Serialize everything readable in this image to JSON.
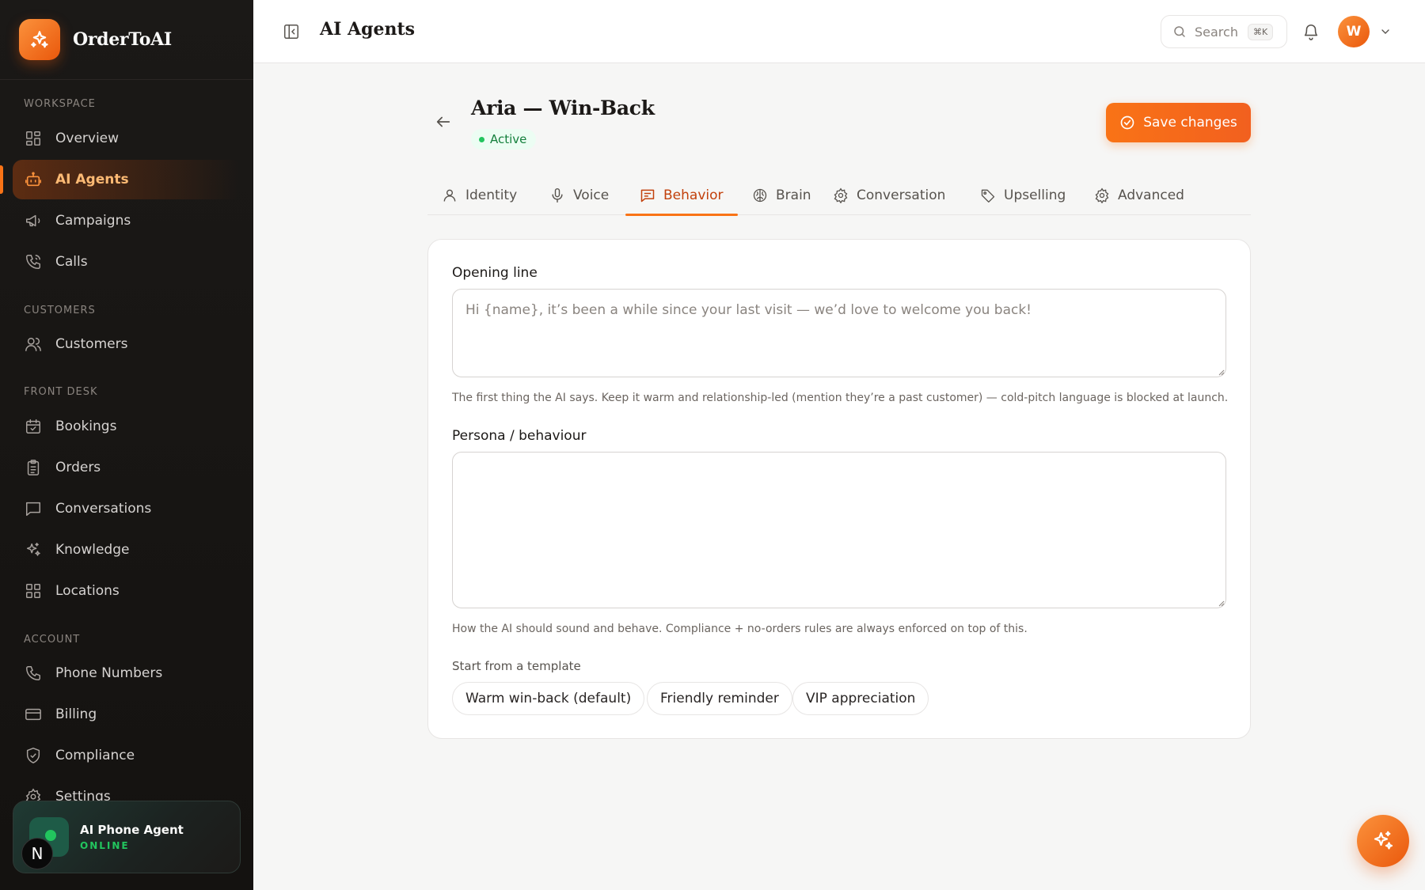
{
  "app": {
    "name": "OrderToAI",
    "colors": {
      "accent": "#f97316",
      "sidebar_bg": "#1b1917",
      "success": "#22c55e"
    }
  },
  "sidebar": {
    "sections": [
      {
        "label": "WORKSPACE"
      },
      {
        "label": "CUSTOMERS"
      },
      {
        "label": "FRONT DESK"
      },
      {
        "label": "ACCOUNT"
      }
    ],
    "items": [
      {
        "label": "Overview",
        "icon": "grid-icon"
      },
      {
        "label": "AI Agents",
        "icon": "robot-icon",
        "active": true
      },
      {
        "label": "Campaigns",
        "icon": "megaphone-icon"
      },
      {
        "label": "Calls",
        "icon": "phone-call-icon"
      },
      {
        "label": "Customers",
        "icon": "users-icon"
      },
      {
        "label": "Bookings",
        "icon": "calendar-icon"
      },
      {
        "label": "Orders",
        "icon": "clipboard-icon"
      },
      {
        "label": "Conversations",
        "icon": "chat-icon"
      },
      {
        "label": "Knowledge",
        "icon": "sparkles-icon"
      },
      {
        "label": "Locations",
        "icon": "grid-icon"
      },
      {
        "label": "Phone Numbers",
        "icon": "phone-icon"
      },
      {
        "label": "Billing",
        "icon": "credit-card-icon"
      },
      {
        "label": "Compliance",
        "icon": "shield-icon"
      },
      {
        "label": "Settings",
        "icon": "gear-icon"
      }
    ],
    "agent_card": {
      "title": "AI Phone Agent",
      "status": "ONLINE",
      "badge": "N"
    }
  },
  "topbar": {
    "title": "AI Agents",
    "search": {
      "placeholder": "Search",
      "shortcut": "⌘K"
    },
    "user_initial": "W"
  },
  "agent": {
    "name": "Aria — Win-Back",
    "status": "Active",
    "save_label": "Save changes"
  },
  "tabs": [
    {
      "label": "Identity",
      "icon": "user-icon"
    },
    {
      "label": "Voice",
      "icon": "microphone-icon"
    },
    {
      "label": "Behavior",
      "icon": "message-square-icon",
      "active": true
    },
    {
      "label": "Brain",
      "icon": "brain-icon"
    },
    {
      "label": "Conversation",
      "icon": "gear-icon"
    },
    {
      "label": "Upselling",
      "icon": "tag-icon"
    },
    {
      "label": "Advanced",
      "icon": "gear-icon"
    }
  ],
  "behavior": {
    "opening_line": {
      "label": "Opening line",
      "placeholder": "Hi {name}, it’s been a while since your last visit — we’d love to welcome you back!",
      "value": "",
      "help": "The first thing the AI says. Keep it warm and relationship-led (mention they’re a past customer) — cold-pitch language is blocked at launch."
    },
    "persona": {
      "label": "Persona / behaviour",
      "value": "",
      "help": "How the AI should sound and behave. Compliance + no-orders rules are always enforced on top of this."
    },
    "templates": {
      "label": "Start from a template",
      "options": [
        "Warm win-back (default)",
        "Friendly reminder",
        "VIP appreciation"
      ]
    }
  }
}
